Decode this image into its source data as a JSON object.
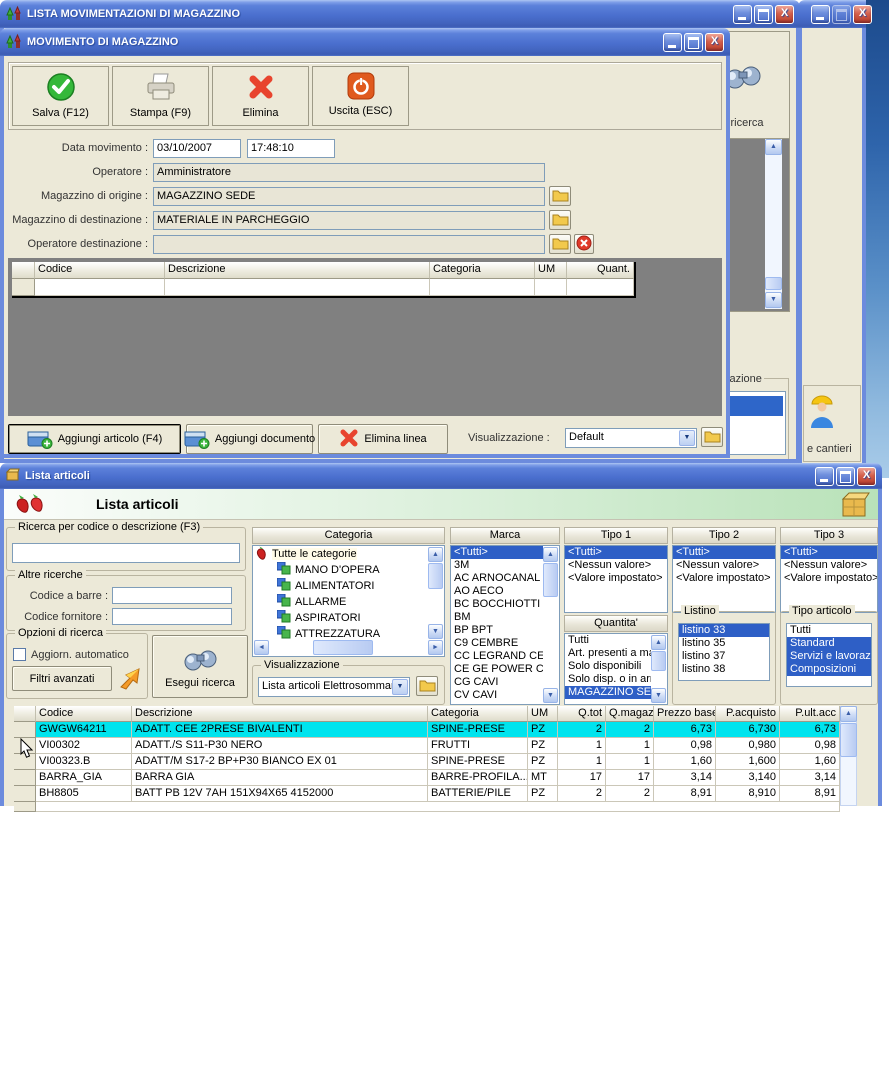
{
  "main_window": {
    "cantieri_label": "e cantieri"
  },
  "lista_movimentazioni": {
    "title": "LISTA MOVIMENTAZIONI DI MAGAZZINO",
    "ricerca_button_fragment": "i ricerca",
    "visualizzazione_fragment": "zazione"
  },
  "movimento": {
    "title": "MOVIMENTO DI MAGAZZINO",
    "toolbar": {
      "salva": "Salva (F12)",
      "stampa": "Stampa (F9)",
      "elimina": "Elimina",
      "uscita": "Uscita (ESC)"
    },
    "form": {
      "data_movimento_label": "Data movimento :",
      "data_value": "03/10/2007",
      "ora_value": "17:48:10",
      "operatore_label": "Operatore :",
      "operatore_value": "Amministratore",
      "origine_label": "Magazzino di origine :",
      "origine_value": "MAGAZZINO SEDE",
      "destinazione_label": "Magazzino di destinazione :",
      "destinazione_value": "MATERIALE IN PARCHEGGIO",
      "operatore_dest_label": "Operatore destinazione :",
      "operatore_dest_value": ""
    },
    "grid": {
      "columns": [
        "Codice",
        "Descrizione",
        "Categoria",
        "UM",
        "Quant."
      ]
    },
    "footer": {
      "aggiungi_articolo": "Aggiungi articolo (F4)",
      "aggiungi_documento": "Aggiungi documento",
      "elimina_linea": "Elimina linea",
      "visualizzazione_label": "Visualizzazione :",
      "visualizzazione_value": "Default"
    }
  },
  "lista_articoli": {
    "title": "Lista articoli",
    "heading": "Lista articoli",
    "search": {
      "ricerca_group": "Ricerca per codice o descrizione (F3)",
      "ricerca_value": "",
      "altre_group": "Altre ricerche",
      "codice_barre_label": "Codice a barre :",
      "codice_barre_value": "",
      "codice_fornitore_label": "Codice fornitore :",
      "codice_fornitore_value": "",
      "opzioni_group": "Opzioni di ricerca",
      "aggiorn_checkbox": "Aggiorn. automatico",
      "filtri_button": "Filtri avanzati",
      "esegui_button": "Esegui ricerca"
    },
    "categoria": {
      "header": "Categoria",
      "root": "Tutte le categorie",
      "items": [
        "MANO D'OPERA",
        "ALIMENTATORI",
        "ALLARME",
        "ASPIRATORI",
        "ATTREZZATURA"
      ]
    },
    "visualizzazione": {
      "label": "Visualizzazione",
      "value": "Lista articoli Elettrosommaru"
    },
    "marca": {
      "header": "Marca",
      "items": [
        "<Tutti>",
        "3M",
        "AC ARNOCANAL",
        "AO AECO",
        "BC BOCCHIOTTI",
        "BM",
        "BP BPT",
        "C9 CEMBRE",
        "CC LEGRAND CE",
        "CE GE POWER C",
        "CG CAVI",
        "CV CAVI"
      ]
    },
    "tipo1": {
      "header": "Tipo 1",
      "items": [
        "<Tutti>",
        "<Nessun valore>",
        "<Valore impostato>"
      ]
    },
    "tipo2": {
      "header": "Tipo 2",
      "items": [
        "<Tutti>",
        "<Nessun valore>",
        "<Valore impostato>"
      ]
    },
    "tipo3": {
      "header": "Tipo 3",
      "items": [
        "<Tutti>",
        "<Nessun valore>",
        "<Valore impostato>"
      ]
    },
    "quantita": {
      "header": "Quantita'",
      "items": [
        "Tutti",
        "Art. presenti a magaz:",
        "Solo disponibili",
        "Solo disp. o in arrivo",
        "MAGAZZINO SEDE"
      ]
    },
    "listino": {
      "label": "Listino",
      "items": [
        "listino 33",
        "listino 35",
        "listino 37",
        "listino 38"
      ]
    },
    "tipo_articolo": {
      "label": "Tipo articolo",
      "items": [
        "Tutti",
        "Standard",
        "Servizi e lavoraz",
        "Composizioni"
      ]
    },
    "table": {
      "columns": [
        "Codice",
        "Descrizione",
        "Categoria",
        "UM",
        "Q.tot",
        "Q.magaz",
        "Prezzo base",
        "P.acquisto",
        "P.ult.acc"
      ],
      "rows": [
        [
          "GWGW64211",
          "ADATT. CEE 2PRESE BIVALENTI",
          "SPINE-PRESE",
          "PZ",
          "2",
          "2",
          "6,73",
          "6,730",
          "6,73"
        ],
        [
          "VI00302",
          "ADATT./S S11-P30 NERO",
          "FRUTTI",
          "PZ",
          "1",
          "1",
          "0,98",
          "0,980",
          "0,98"
        ],
        [
          "VI00323.B",
          "ADATT/M S17-2 BP+P30 BIANCO EX 01",
          "SPINE-PRESE",
          "PZ",
          "1",
          "1",
          "1,60",
          "1,600",
          "1,60"
        ],
        [
          "BARRA_GIA",
          "BARRA GIA",
          "BARRE-PROFILA...",
          "MT",
          "17",
          "17",
          "3,14",
          "3,140",
          "3,14"
        ],
        [
          "BH8805",
          "BATT PB 12V 7AH 151X94X65 4152000",
          "BATTERIE/PILE",
          "PZ",
          "2",
          "2",
          "8,91",
          "8,910",
          "8,91"
        ]
      ]
    }
  }
}
